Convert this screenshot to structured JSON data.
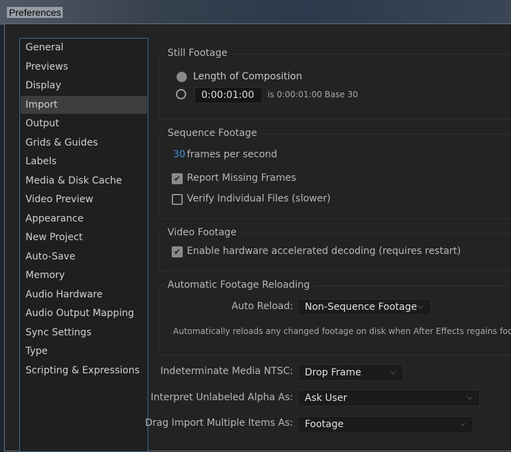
{
  "window": {
    "title": "Preferences"
  },
  "sidebar": {
    "selected": "Import",
    "items": [
      {
        "label": "General"
      },
      {
        "label": "Previews"
      },
      {
        "label": "Display"
      },
      {
        "label": "Import"
      },
      {
        "label": "Output"
      },
      {
        "label": "Grids & Guides"
      },
      {
        "label": "Labels"
      },
      {
        "label": "Media & Disk Cache"
      },
      {
        "label": "Video Preview"
      },
      {
        "label": "Appearance"
      },
      {
        "label": "New Project"
      },
      {
        "label": "Auto-Save"
      },
      {
        "label": "Memory"
      },
      {
        "label": "Audio Hardware"
      },
      {
        "label": "Audio Output Mapping"
      },
      {
        "label": "Sync Settings"
      },
      {
        "label": "Type"
      },
      {
        "label": "Scripting & Expressions"
      }
    ]
  },
  "still": {
    "title": "Still Footage",
    "opt1": "Length of Composition",
    "duration": "0:00:01:00",
    "duration_info": "is 0:00:01:00  Base 30"
  },
  "sequence": {
    "title": "Sequence Footage",
    "fps": "30",
    "fps_label": "frames per second",
    "report_missing": "Report Missing Frames",
    "report_missing_checked": true,
    "verify": "Verify Individual Files (slower)",
    "verify_checked": false
  },
  "video": {
    "title": "Video Footage",
    "hw_decode": "Enable hardware accelerated decoding (requires restart)",
    "hw_decode_checked": true
  },
  "reload": {
    "title": "Automatic Footage Reloading",
    "label": "Auto Reload:",
    "value": "Non-Sequence Footage",
    "note": "Automatically reloads any changed footage on disk when After Effects regains focus."
  },
  "ntsc": {
    "label": "Indeterminate Media NTSC:",
    "value": "Drop Frame"
  },
  "alpha": {
    "label": "Interpret Unlabeled Alpha As:",
    "value": "Ask User"
  },
  "drag": {
    "label": "Drag Import Multiple Items As:",
    "value": "Footage"
  },
  "colors": {
    "accent": "#4a90d9",
    "selected_bg": "#3d3d3d",
    "bg": "#232323"
  }
}
